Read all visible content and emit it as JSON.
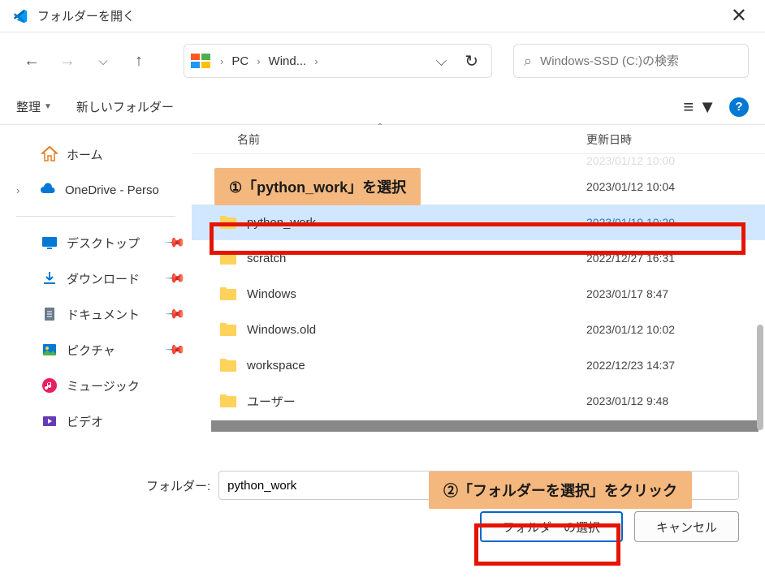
{
  "titlebar": {
    "title": "フォルダーを開く"
  },
  "breadcrumbs": [
    "PC",
    "Wind..."
  ],
  "search": {
    "placeholder": "Windows-SSD (C:)の検索"
  },
  "toolbar": {
    "organize": "整理",
    "new_folder": "新しいフォルダー"
  },
  "col_headers": {
    "name": "名前",
    "date": "更新日時"
  },
  "sidebar": {
    "home": "ホーム",
    "onedrive": "OneDrive - Perso",
    "quick": [
      {
        "label": "デスクトップ"
      },
      {
        "label": "ダウンロード"
      },
      {
        "label": "ドキュメント"
      },
      {
        "label": "ピクチャ"
      },
      {
        "label": "ミュージック"
      },
      {
        "label": "ビデオ"
      }
    ]
  },
  "files": [
    {
      "name": "",
      "date": "2023/01/12 10:00",
      "partial": true
    },
    {
      "name": "",
      "date": "2023/01/12 10:04"
    },
    {
      "name": "python_work",
      "date": "2023/01/19 10:29",
      "selected": true
    },
    {
      "name": "scratch",
      "date": "2022/12/27 16:31"
    },
    {
      "name": "Windows",
      "date": "2023/01/17 8:47"
    },
    {
      "name": "Windows.old",
      "date": "2023/01/12 10:02"
    },
    {
      "name": "workspace",
      "date": "2022/12/23 14:37"
    },
    {
      "name": "ユーザー",
      "date": "2023/01/12 9:48"
    }
  ],
  "callouts": {
    "one": "①「python_work」を選択",
    "two": "②「フォルダーを選択」をクリック"
  },
  "footer": {
    "label": "フォルダー:",
    "value": "python_work",
    "select_btn": "フォルダーの選択",
    "cancel_btn": "キャンセル"
  }
}
